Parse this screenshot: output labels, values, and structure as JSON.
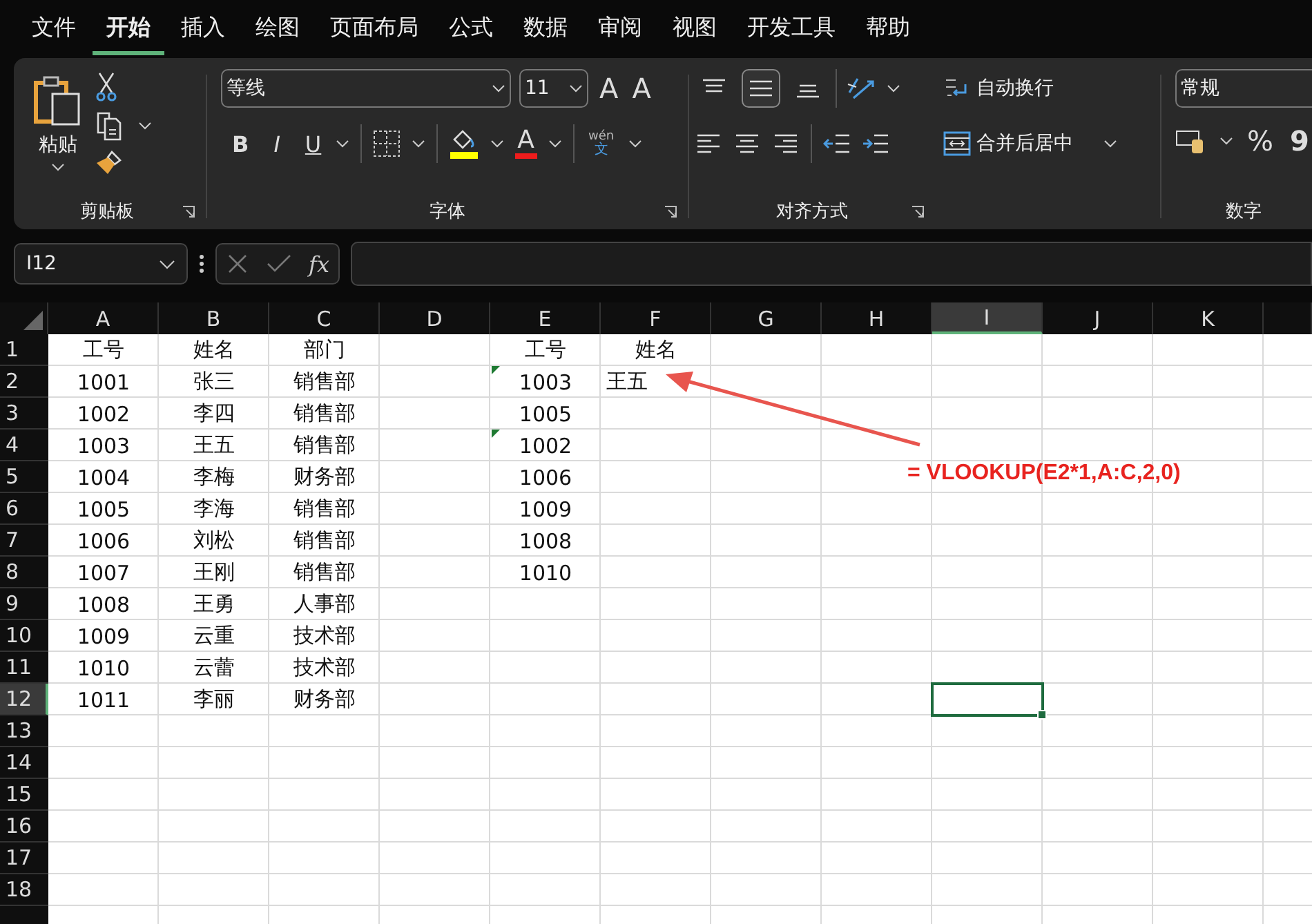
{
  "menu_tabs": [
    {
      "label": "文件",
      "selected": false
    },
    {
      "label": "开始",
      "selected": true
    },
    {
      "label": "插入",
      "selected": false
    },
    {
      "label": "绘图",
      "selected": false
    },
    {
      "label": "页面布局",
      "selected": false
    },
    {
      "label": "公式",
      "selected": false
    },
    {
      "label": "数据",
      "selected": false
    },
    {
      "label": "审阅",
      "selected": false
    },
    {
      "label": "视图",
      "selected": false
    },
    {
      "label": "开发工具",
      "selected": false
    },
    {
      "label": "帮助",
      "selected": false
    }
  ],
  "ribbon": {
    "clipboard": {
      "paste_label": "粘贴",
      "group_label": "剪贴板"
    },
    "font": {
      "font_name": "等线",
      "font_size": "11",
      "grow_label": "A",
      "shrink_label": "A",
      "bold_label": "B",
      "italic_label": "I",
      "underline_label": "U",
      "font_color_label": "A",
      "phonetic_top": "wén",
      "phonetic_bottom": "文",
      "group_label": "字体"
    },
    "alignment": {
      "vertical_buttons": [
        {
          "kind": "top",
          "selected": false
        },
        {
          "kind": "middle",
          "selected": true
        },
        {
          "kind": "bottom",
          "selected": false
        }
      ],
      "group_label": "对齐方式"
    },
    "wrap_text_label": "自动换行",
    "merge_label": "合并后居中",
    "number": {
      "format": "常规",
      "percent_label": "%",
      "comma_label": "9",
      "group_label": "数字"
    }
  },
  "formula_bar": {
    "name_box": "I12",
    "fx_label": "fx"
  },
  "sheet": {
    "columns": [
      {
        "label": "A",
        "selected": false
      },
      {
        "label": "B",
        "selected": false
      },
      {
        "label": "C",
        "selected": false
      },
      {
        "label": "D",
        "selected": false
      },
      {
        "label": "E",
        "selected": false
      },
      {
        "label": "F",
        "selected": false
      },
      {
        "label": "G",
        "selected": false
      },
      {
        "label": "H",
        "selected": false
      },
      {
        "label": "I",
        "selected": true
      },
      {
        "label": "J",
        "selected": false
      },
      {
        "label": "K",
        "selected": false
      }
    ],
    "rows": [
      {
        "number": "1",
        "selected": false,
        "flagged": false,
        "cells": [
          "工号",
          "姓名",
          "部门",
          "",
          "工号",
          "姓名"
        ]
      },
      {
        "number": "2",
        "selected": false,
        "flagged": true,
        "cells": [
          "1001",
          "张三",
          "销售部",
          "",
          "1003",
          "王五"
        ]
      },
      {
        "number": "3",
        "selected": false,
        "flagged": false,
        "cells": [
          "1002",
          "李四",
          "销售部",
          "",
          "1005"
        ]
      },
      {
        "number": "4",
        "selected": false,
        "flagged": true,
        "cells": [
          "1003",
          "王五",
          "销售部",
          "",
          "1002"
        ]
      },
      {
        "number": "5",
        "selected": false,
        "flagged": false,
        "cells": [
          "1004",
          "李梅",
          "财务部",
          "",
          "1006"
        ]
      },
      {
        "number": "6",
        "selected": false,
        "flagged": false,
        "cells": [
          "1005",
          "李海",
          "销售部",
          "",
          "1009"
        ]
      },
      {
        "number": "7",
        "selected": false,
        "flagged": false,
        "cells": [
          "1006",
          "刘松",
          "销售部",
          "",
          "1008"
        ]
      },
      {
        "number": "8",
        "selected": false,
        "flagged": false,
        "cells": [
          "1007",
          "王刚",
          "销售部",
          "",
          "1010"
        ]
      },
      {
        "number": "9",
        "selected": false,
        "flagged": false,
        "cells": [
          "1008",
          "王勇",
          "人事部"
        ]
      },
      {
        "number": "10",
        "selected": false,
        "flagged": false,
        "cells": [
          "1009",
          "云重",
          "技术部"
        ]
      },
      {
        "number": "11",
        "selected": false,
        "flagged": false,
        "cells": [
          "1010",
          "云蕾",
          "技术部"
        ]
      },
      {
        "number": "12",
        "selected": true,
        "flagged": false,
        "cells": [
          "1011",
          "李丽",
          "财务部"
        ]
      },
      {
        "number": "13",
        "selected": false,
        "flagged": false
      },
      {
        "number": "14",
        "selected": false,
        "flagged": false
      },
      {
        "number": "15",
        "selected": false,
        "flagged": false
      },
      {
        "number": "16",
        "selected": false,
        "flagged": false
      },
      {
        "number": "17",
        "selected": false,
        "flagged": false
      },
      {
        "number": "18",
        "selected": false,
        "flagged": false
      }
    ]
  },
  "annotation": {
    "text": "= VLOOKUP(E2*1,A:C,2,0)"
  }
}
